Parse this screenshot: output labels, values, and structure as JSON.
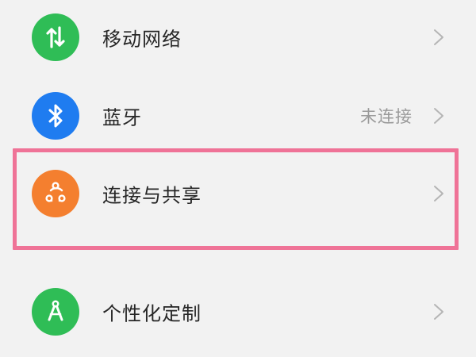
{
  "items": [
    {
      "label": "移动网络",
      "status": "",
      "icon": "mobile-data-arrows-icon",
      "color": "#2fbd56"
    },
    {
      "label": "蓝牙",
      "status": "未连接",
      "icon": "bluetooth-icon",
      "color": "#1f7cf0"
    },
    {
      "label": "连接与共享",
      "status": "",
      "icon": "connection-share-icon",
      "color": "#f47f2f"
    },
    {
      "label": "个性化定制",
      "status": "",
      "icon": "compass-icon",
      "color": "#2fbd56"
    }
  ],
  "highlight_color": "#ef7397",
  "chevron_icon": "chevron-right-icon"
}
